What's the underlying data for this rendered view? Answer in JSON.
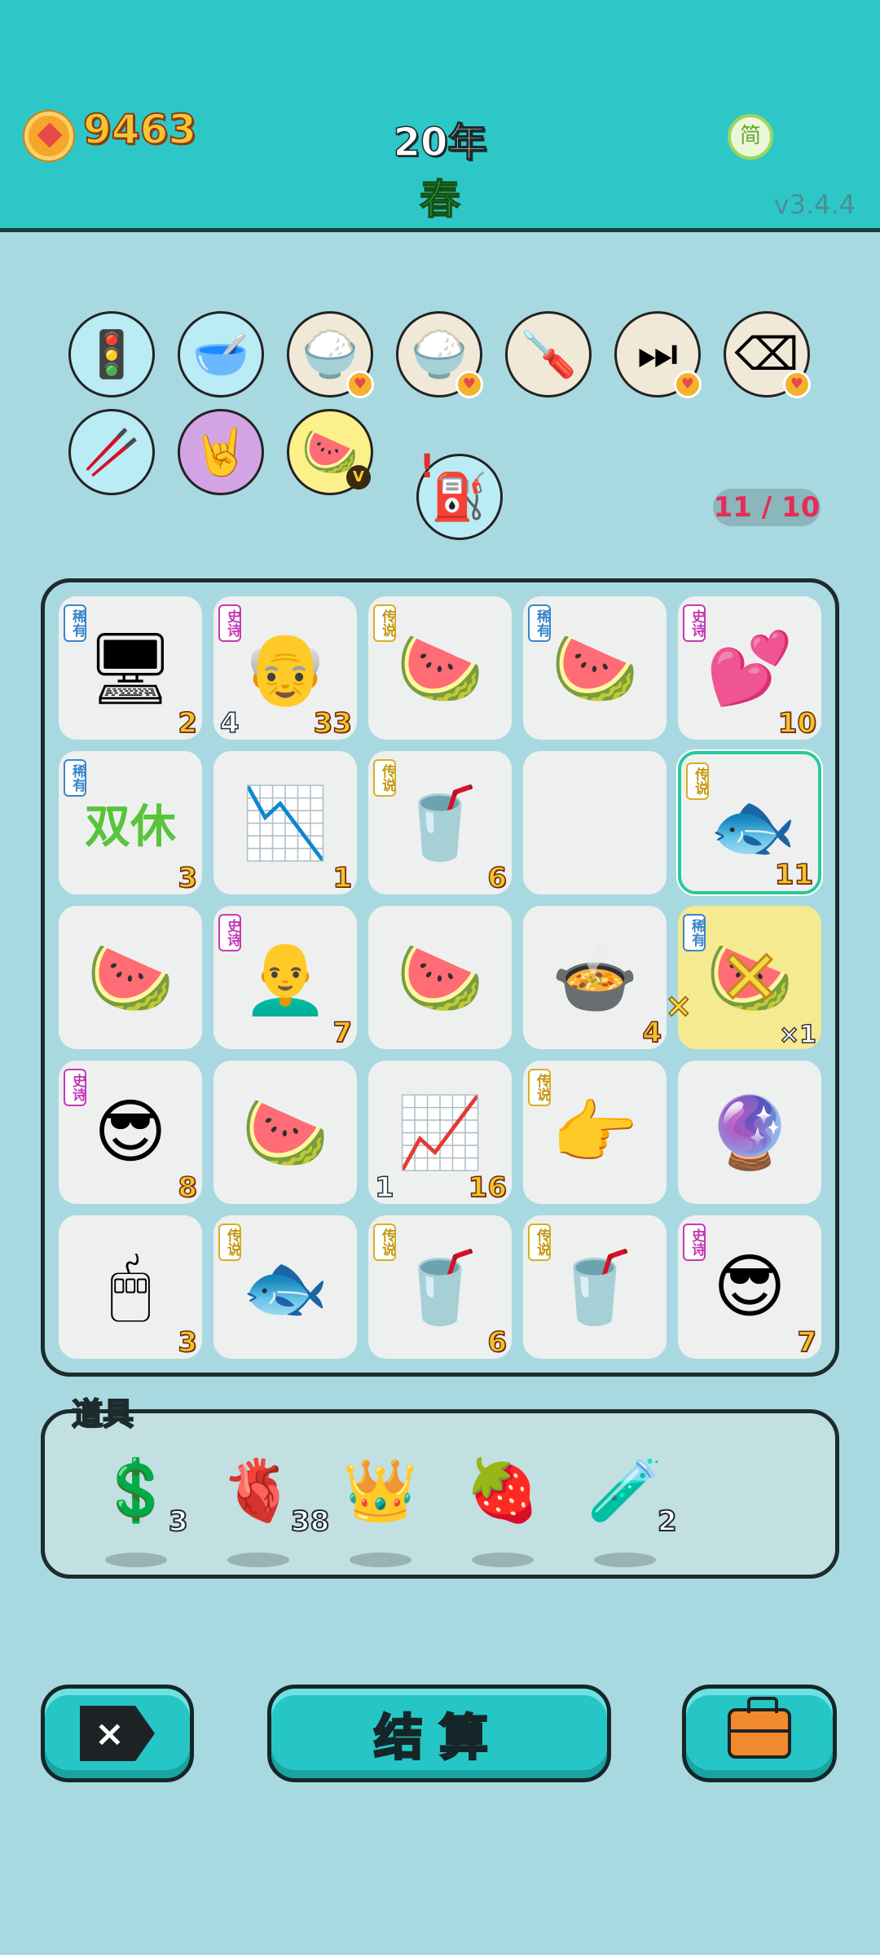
{
  "header": {
    "coins": "9463",
    "year": "20年",
    "season": "春",
    "lang_button": "简",
    "version": "v3.4.4"
  },
  "relics": [
    {
      "icon": "traffic-light-ghost-icon",
      "glyph": "🚦",
      "style": "blue"
    },
    {
      "icon": "dog-bowl-icon",
      "glyph": "🥣",
      "style": "blue"
    },
    {
      "icon": "rice-bowl-icon",
      "glyph": "🍚",
      "style": "plain",
      "heart": true
    },
    {
      "icon": "rice-bowl-icon",
      "glyph": "🍚",
      "style": "plain",
      "heart": true
    },
    {
      "icon": "screwdriver-icon",
      "glyph": "🪛",
      "style": "plain"
    },
    {
      "icon": "skip-icon",
      "glyph": "⏭",
      "style": "plain",
      "heart": true
    },
    {
      "icon": "delete-tag-icon",
      "glyph": "⌫",
      "style": "plain",
      "heart": true
    },
    {
      "icon": "chopsticks-icon",
      "glyph": "🥢",
      "style": "blue"
    },
    {
      "icon": "rock-hand-icon",
      "glyph": "🤘",
      "style": "purple"
    },
    {
      "icon": "fruit-basket-icon",
      "glyph": "🍉",
      "style": "yellow",
      "vip": "V"
    },
    {
      "icon": "air-pump-icon",
      "glyph": "⛽",
      "style": "blue"
    }
  ],
  "pump_warning": "!",
  "slot_count": "11 / 10",
  "board": [
    {
      "name": "server-tower",
      "glyph": "🖥",
      "tag": "稀有",
      "tag_type": "rare",
      "num": "2"
    },
    {
      "name": "old-man-glasses",
      "glyph": "👴",
      "tag": "史诗",
      "tag_type": "epic",
      "num": "33",
      "left_num": "4"
    },
    {
      "name": "watermelon-whole",
      "glyph": "🍉",
      "tag": "传说",
      "tag_type": "legend",
      "num": ""
    },
    {
      "name": "watermelon-slice",
      "glyph": "🍉",
      "tag": "稀有",
      "tag_type": "rare",
      "num": ""
    },
    {
      "name": "girl-hearts",
      "glyph": "💕",
      "tag": "史诗",
      "tag_type": "epic",
      "num": "10"
    },
    {
      "name": "double-rest",
      "glyph": "",
      "text": "双休",
      "tag": "稀有",
      "tag_type": "rare",
      "num": "3"
    },
    {
      "name": "falling-chart",
      "glyph": "📉",
      "num": "1"
    },
    {
      "name": "bubble-tea",
      "glyph": "🥤",
      "tag": "传说",
      "tag_type": "legend",
      "num": "6"
    },
    {
      "name": "empty",
      "glyph": "",
      "num": ""
    },
    {
      "name": "koi-fish",
      "glyph": "🐟",
      "tag": "传说",
      "tag_type": "legend",
      "num": "11",
      "highlight": true
    },
    {
      "name": "watermelon-piece",
      "glyph": "🍉",
      "num": ""
    },
    {
      "name": "bald-old-man",
      "glyph": "👨‍🦲",
      "tag": "史诗",
      "tag_type": "epic",
      "num": "7"
    },
    {
      "name": "watermelon-piece",
      "glyph": "🍉",
      "num": ""
    },
    {
      "name": "soup-bowl",
      "glyph": "🍲",
      "num": "4"
    },
    {
      "name": "watermelon-crossed",
      "glyph": "🍉",
      "tag": "稀有",
      "tag_type": "rare",
      "mult": "×1",
      "crossed": true
    },
    {
      "name": "green-hat-man",
      "glyph": "😎",
      "tag": "史诗",
      "tag_type": "epic",
      "num": "8"
    },
    {
      "name": "watermelon-piece",
      "glyph": "🍉",
      "num": ""
    },
    {
      "name": "rising-chart",
      "glyph": "📈",
      "num": "16",
      "left_num": "1"
    },
    {
      "name": "pointing-hand",
      "glyph": "👉",
      "tag": "传说",
      "tag_type": "legend",
      "num": ""
    },
    {
      "name": "gacha-ball",
      "glyph": "🔮",
      "num": ""
    },
    {
      "name": "computer-mouse",
      "glyph": "🖱",
      "num": "3"
    },
    {
      "name": "koi-fish",
      "glyph": "🐟",
      "tag": "传说",
      "tag_type": "legend",
      "num": ""
    },
    {
      "name": "bubble-tea",
      "glyph": "🥤",
      "tag": "传说",
      "tag_type": "legend",
      "num": "6"
    },
    {
      "name": "bubble-tea",
      "glyph": "🥤",
      "tag": "传说",
      "tag_type": "legend",
      "num": ""
    },
    {
      "name": "green-hat-man",
      "glyph": "😎",
      "tag": "史诗",
      "tag_type": "epic",
      "num": "7"
    }
  ],
  "cross_between": "×",
  "items": {
    "title": "道具",
    "list": [
      {
        "icon": "dollar-coin-icon",
        "glyph": "💲",
        "count": "3"
      },
      {
        "icon": "liver-icon",
        "glyph": "🫀",
        "count": "38"
      },
      {
        "icon": "crown-icon",
        "glyph": "👑",
        "count": ""
      },
      {
        "icon": "lychee-icon",
        "glyph": "🍓",
        "count": ""
      },
      {
        "icon": "test-tubes-icon",
        "glyph": "🧪",
        "count": "2"
      }
    ]
  },
  "buttons": {
    "delete_glyph": "×",
    "settle_label": "结算",
    "bag_icon": "briefcase-icon"
  }
}
